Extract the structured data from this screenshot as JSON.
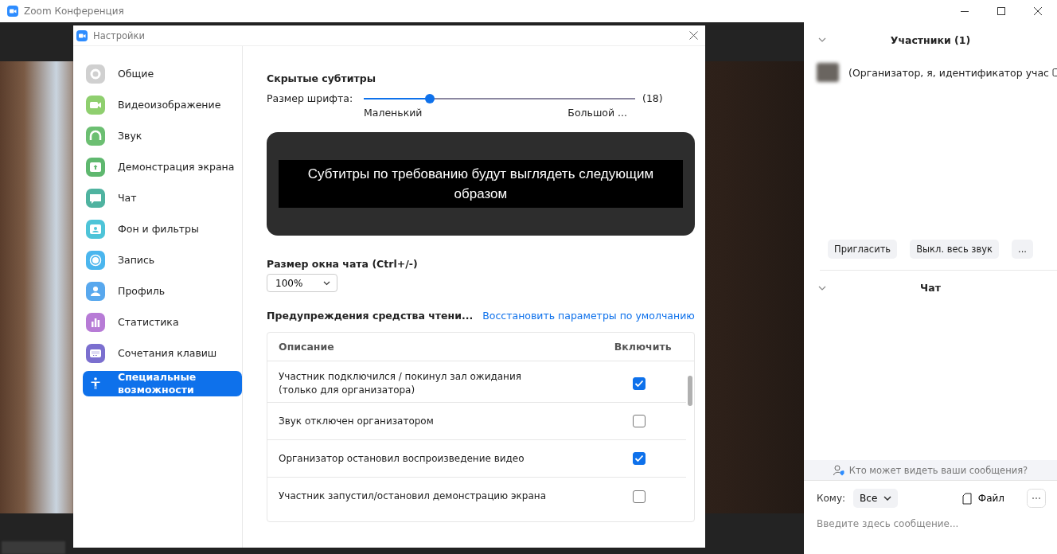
{
  "app_window": {
    "title": "Zoom Конференция"
  },
  "settings_dialog": {
    "title": "Настройки",
    "sidebar": {
      "items": [
        {
          "label": "Общие",
          "color": "#d0d0d0",
          "selected": false
        },
        {
          "label": "Видеоизображение",
          "color": "#8fcf6f",
          "selected": false
        },
        {
          "label": "Звук",
          "color": "#6cbf72",
          "selected": false
        },
        {
          "label": "Демонстрация экрана",
          "color": "#5fb86f",
          "selected": false
        },
        {
          "label": "Чат",
          "color": "#4fb3a0",
          "selected": false
        },
        {
          "label": "Фон и фильтры",
          "color": "#4ec4d8",
          "selected": false
        },
        {
          "label": "Запись",
          "color": "#4bb6ee",
          "selected": false
        },
        {
          "label": "Профиль",
          "color": "#58a8ee",
          "selected": false
        },
        {
          "label": "Статистика",
          "color": "#b77bd6",
          "selected": false
        },
        {
          "label": "Сочетания клавиш",
          "color": "#7b6fcf",
          "selected": false
        },
        {
          "label": "Специальные возможности",
          "selected": true
        }
      ]
    },
    "closed_captions": {
      "heading": "Скрытые субтитры",
      "font_size_label": "Размер шрифта:",
      "level": 0.235,
      "reading": "(18)",
      "min_label": "Маленький",
      "max_label": "Большой ...",
      "preview_text": "Субтитры по требованию будут выглядеть следующим образом"
    },
    "chat_window_size": {
      "label": "Размер окна чата (Ctrl+/-)",
      "value": "100%"
    },
    "screen_reader_alerts": {
      "heading": "Предупреждения средства чтени...",
      "reset_link": "Восстановить параметры по умолчанию",
      "columns": [
        "Описание",
        "Включить"
      ],
      "rows": [
        {
          "description": "Участник подключился / покинул зал ожидания (только для организатора)",
          "checked": true
        },
        {
          "description": "Звук отключен организатором",
          "checked": false
        },
        {
          "description": "Организатор остановил воспроизведение видео",
          "checked": true
        },
        {
          "description": "Участник запустил/остановил демонстрацию экрана",
          "checked": false
        }
      ]
    }
  },
  "participants_panel": {
    "title": "Участники (1)",
    "participants": [
      {
        "name": "(Организатор, я, идентификатор учас"
      }
    ],
    "buttons": [
      "Пригласить",
      "Выкл. весь звук",
      "..."
    ]
  },
  "chat_panel": {
    "title": "Чат",
    "privacy_notice": "Кто может видеть ваши сообщения?",
    "to_label": "Кому:",
    "recipient": "Все",
    "file_button": "Файл",
    "message_placeholder": "Введите здесь сообщение..."
  }
}
